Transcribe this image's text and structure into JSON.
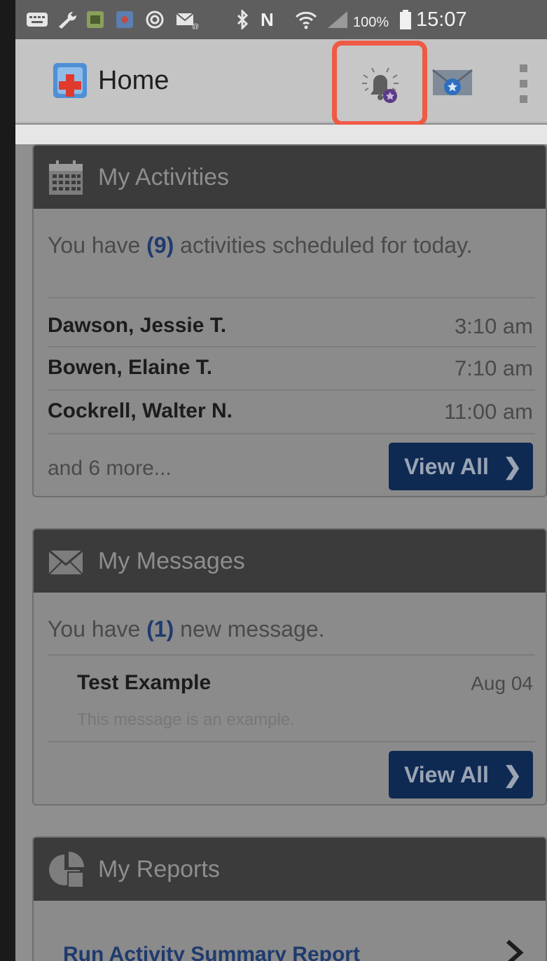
{
  "status_bar": {
    "network_letter": "N",
    "battery_percent": "100%",
    "time": "15:07"
  },
  "action_bar": {
    "title": "Home"
  },
  "activities": {
    "title": "My Activities",
    "summary_prefix": "You have ",
    "count": "(9)",
    "summary_suffix": " activities scheduled for today.",
    "items": [
      {
        "name": "Dawson, Jessie T.",
        "time": "3:10 am"
      },
      {
        "name": "Bowen, Elaine T.",
        "time": "7:10 am"
      },
      {
        "name": "Cockrell, Walter N.",
        "time": "11:00 am"
      }
    ],
    "more_text": "and 6 more...",
    "view_all_label": "View All",
    "chevron": "❯"
  },
  "messages": {
    "title": "My Messages",
    "summary_prefix": "You have ",
    "count": "(1)",
    "summary_suffix": " new message.",
    "items": [
      {
        "subject": "Test Example",
        "date": "Aug 04",
        "preview": "This message is an example."
      }
    ],
    "view_all_label": "View All",
    "chevron": "❯"
  },
  "reports": {
    "title": "My Reports",
    "items": [
      {
        "label": "Run Activity Summary Report"
      }
    ]
  },
  "colors": {
    "highlight_border": "#ef5a45",
    "button_bg": "#0f2a52",
    "count_color": "#1f3b6e",
    "header_bg": "#3b3b3b"
  },
  "icons": {
    "status_bar": [
      "keyboard-icon",
      "wrench-icon",
      "app-icon",
      "app-icon",
      "target-icon",
      "email-icon",
      "bluetooth-icon",
      "nfc-icon",
      "wifi-icon",
      "signal-icon",
      "battery-icon"
    ],
    "app_logo": "medical-cross-logo",
    "alerts": "bell-icon",
    "messages": "envelope-icon",
    "overflow": "more-vertical-icon",
    "activities": "calendar-icon",
    "messages_card": "envelope-icon",
    "reports": "pie-chart-icon"
  }
}
